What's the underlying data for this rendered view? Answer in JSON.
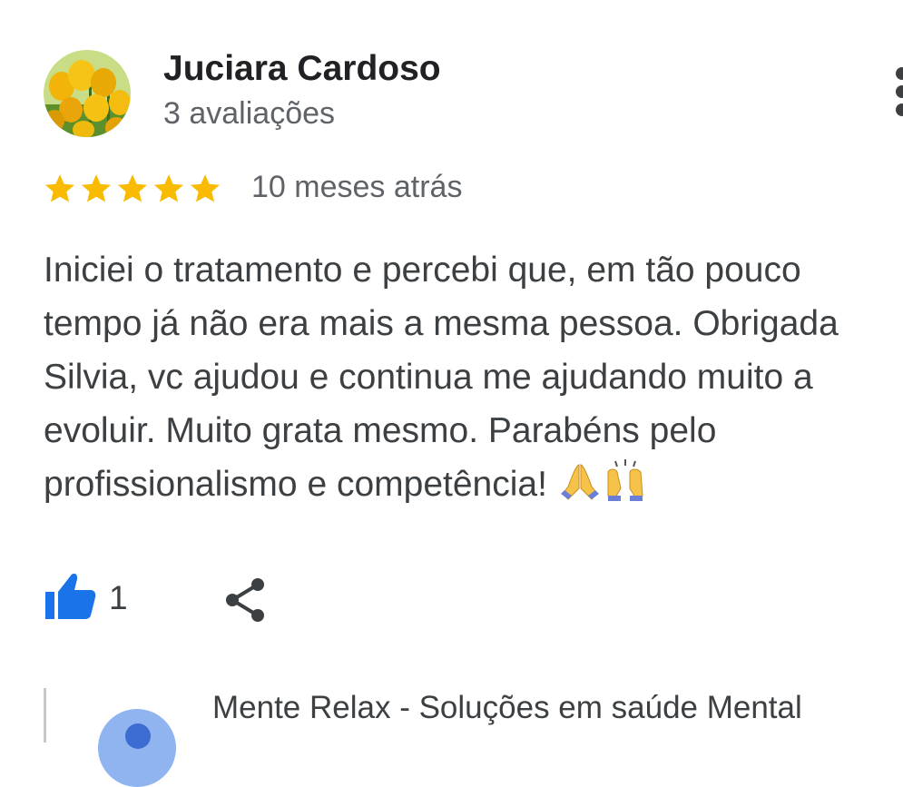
{
  "review": {
    "reviewer_name": "Juciara Cardoso",
    "review_count": "3 avaliações",
    "rating": 5,
    "rating_max": 5,
    "date": "10 meses atrás",
    "text": "Iniciei o tratamento e percebi que, em tão pouco tempo já não era mais a mesma pessoa. Obrigada Silvia, vc ajudou e continua me ajudando muito a evoluir. Muito grata mesmo. Parabéns pelo profissionalismo e competência!",
    "emojis": [
      "praying-hands-emoji",
      "raised-hands-emoji"
    ],
    "like_count": "1"
  },
  "owner_response": {
    "name": "Mente Relax - Soluções em saúde Mental"
  },
  "icons": {
    "avatar": "tulips-photo",
    "more": "more-vert-icon",
    "star": "star-icon",
    "like": "thumbs-up-icon",
    "share": "share-icon"
  },
  "colors": {
    "star": "#f9bb00",
    "like": "#1a73e8",
    "name": "#202124",
    "secondary": "#5f6368",
    "body": "#3c4043"
  }
}
